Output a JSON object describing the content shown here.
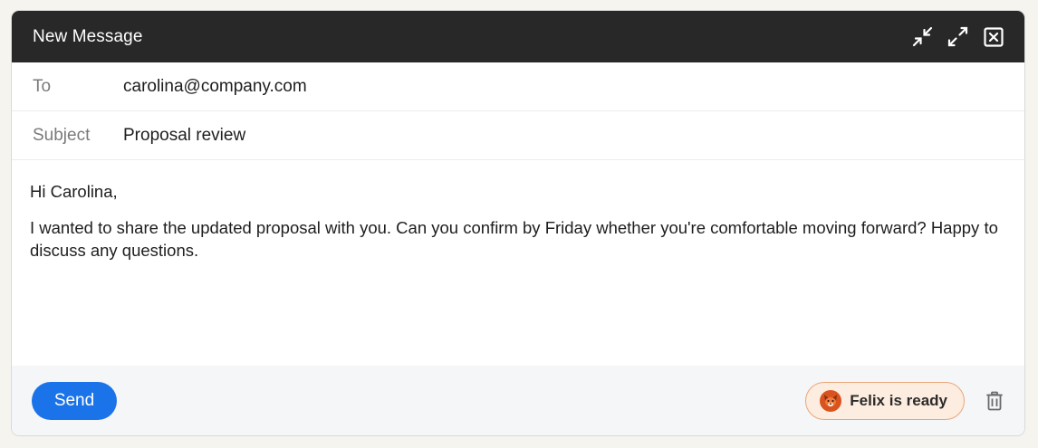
{
  "window": {
    "title": "New Message",
    "controls": [
      "minimize-icon",
      "expand-icon",
      "close-icon"
    ]
  },
  "fields": {
    "to_label": "To",
    "to_value": "carolina@company.com",
    "subject_label": "Subject",
    "subject_value": "Proposal review"
  },
  "message": {
    "greeting": "Hi Carolina,",
    "paragraph": "I wanted to share the updated proposal with you. Can you confirm by Friday whether you're comfortable moving forward? Happy to discuss any questions."
  },
  "footer": {
    "send_label": "Send",
    "assistant_label": "Felix is ready",
    "assistant_icon": "fox-avatar-icon",
    "trash_icon": "trash-icon"
  },
  "colors": {
    "titlebar": "#282828",
    "send": "#1a73e8",
    "assistant_bg": "#fdece0",
    "assistant_border": "#e9a77b",
    "fox": "#d9531e"
  }
}
